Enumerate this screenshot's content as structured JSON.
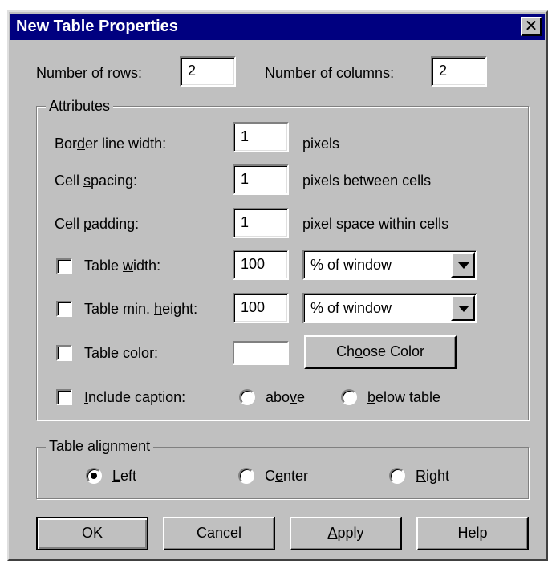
{
  "dialog": {
    "title": "New Table Properties",
    "close_glyph": "✕"
  },
  "rows": {
    "label_pre": "",
    "label_u": "N",
    "label_post": "umber of rows:",
    "value": "2"
  },
  "cols": {
    "label_pre": "N",
    "label_u": "u",
    "label_post": "mber of columns:",
    "value": "2"
  },
  "attributes": {
    "legend": "Attributes",
    "border": {
      "label_pre": "Bor",
      "label_u": "d",
      "label_post": "er line width:",
      "value": "1",
      "unit": "pixels"
    },
    "spacing": {
      "label_pre": "Cell ",
      "label_u": "s",
      "label_post": "pacing:",
      "value": "1",
      "unit": "pixels between cells"
    },
    "padding": {
      "label_pre": "Cell ",
      "label_u": "p",
      "label_post": "adding:",
      "value": "1",
      "unit": "pixel space within cells"
    },
    "width": {
      "label_pre": "Table ",
      "label_u": "w",
      "label_post": "idth:",
      "value": "100",
      "unit": "% of window",
      "checked": false
    },
    "height": {
      "label_pre": "Table min. ",
      "label_u": "h",
      "label_post": "eight:",
      "value": "100",
      "unit": "% of window",
      "checked": false
    },
    "color": {
      "label_pre": "Table ",
      "label_u": "c",
      "label_post": "olor:",
      "button_pre": "Ch",
      "button_u": "o",
      "button_post": "ose Color",
      "checked": false,
      "swatch": "#ffffff"
    },
    "caption": {
      "label_pre": "",
      "label_u": "I",
      "label_post": "nclude caption:",
      "checked": false,
      "above_pre": "abo",
      "above_u": "v",
      "above_post": "e",
      "below_pre": "",
      "below_u": "b",
      "below_post": "elow table",
      "selected": "none"
    }
  },
  "alignment": {
    "legend": "Table alignment",
    "left": {
      "pre": "",
      "u": "L",
      "post": "eft"
    },
    "center": {
      "pre": "C",
      "u": "e",
      "post": "nter"
    },
    "right": {
      "pre": "",
      "u": "R",
      "post": "ight"
    },
    "selected": "left"
  },
  "buttons": {
    "ok": "OK",
    "cancel": "Cancel",
    "apply_u": "A",
    "apply_post": "pply",
    "help": "Help"
  }
}
